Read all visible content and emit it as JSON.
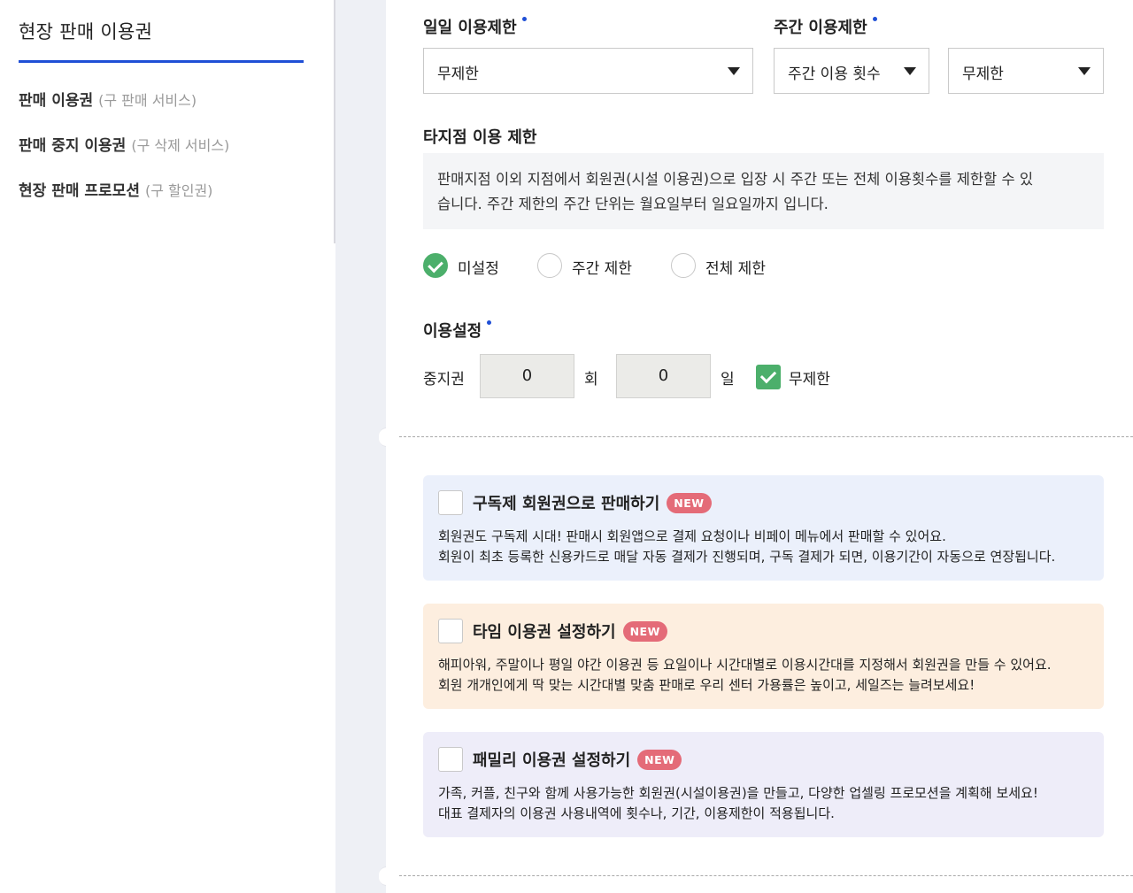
{
  "sidebar": {
    "title": "현장 판매 이용권",
    "items": [
      {
        "label": "판매 이용권",
        "sub": "(구 판매 서비스)"
      },
      {
        "label": "판매 중지 이용권",
        "sub": "(구 삭제 서비스)"
      },
      {
        "label": "현장 판매 프로모션",
        "sub": "(구 할인권)"
      }
    ]
  },
  "daily_limit": {
    "label": "일일 이용제한",
    "value": "무제한"
  },
  "weekly_limit": {
    "label": "주간 이용제한",
    "type_value": "주간 이용 횟수",
    "count_value": "무제한"
  },
  "other_branch": {
    "label": "타지점 이용 제한",
    "info_line1": "판매지점 이외 지점에서 회원권(시설 이용권)으로 입장 시 주간 또는 전체 이용횟수를 제한할 수 있",
    "info_line2": "습니다. 주간 제한의 주간 단위는 월요일부터 일요일까지 입니다.",
    "options": [
      {
        "label": "미설정",
        "selected": true
      },
      {
        "label": "주간 제한",
        "selected": false
      },
      {
        "label": "전체 제한",
        "selected": false
      }
    ]
  },
  "usage_setting": {
    "label": "이용설정",
    "pause_label": "중지권",
    "times_value": "0",
    "times_unit": "회",
    "days_value": "0",
    "days_unit": "일",
    "unlimited_label": "무제한",
    "unlimited_checked": true
  },
  "cards": [
    {
      "title": "구독제 회원권으로 판매하기",
      "badge": "NEW",
      "desc1": "회원권도 구독제 시대! 판매시 회원앱으로 결제 요청이나 비페이 메뉴에서 판매할 수 있어요.",
      "desc2": "회원이 최초 등록한 신용카드로 매달 자동 결제가 진행되며, 구독 결제가 되면, 이용기간이 자동으로 연장됩니다.",
      "bg": "#ebf0fb"
    },
    {
      "title": "타임 이용권 설정하기",
      "badge": "NEW",
      "desc1": "해피아워, 주말이나 평일 야간 이용권 등 요일이나 시간대별로 이용시간대를 지정해서 회원권을 만들 수 있어요.",
      "desc2": "회원 개개인에게 딱 맞는 시간대별 맞춤 판매로 우리 센터 가용률은 높이고, 세일즈는 늘려보세요!",
      "bg": "#fdeedf"
    },
    {
      "title": "패밀리 이용권 설정하기",
      "badge": "NEW",
      "desc1": "가족, 커플, 친구와 함께 사용가능한 회원권(시설이용권)을 만들고, 다양한 업셀링 프로모션을 계획해 보세요!",
      "desc2": "대표 결제자의 이용권 사용내역에 횟수나, 기간, 이용제한이 적용됩니다.",
      "bg": "#eeedf9"
    }
  ],
  "colors": {
    "accent": "#1f4fd6",
    "check_green": "#4caf6b",
    "badge": "#e46b78"
  }
}
